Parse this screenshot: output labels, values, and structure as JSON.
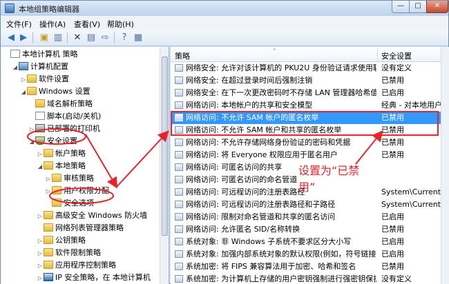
{
  "window": {
    "title": "本地组策略编辑器"
  },
  "caption_buttons": {
    "minimize": "—",
    "maximize": "□",
    "close": "✕"
  },
  "menu": [
    {
      "label": "文件(F)"
    },
    {
      "label": "操作(A)"
    },
    {
      "label": "查看(V)"
    },
    {
      "label": "帮助(H)"
    }
  ],
  "toolbar": {
    "icons": [
      "back-arrow-icon",
      "forward-arrow-icon",
      "up-folder-icon",
      "show-hide-tree-icon",
      "delete-icon",
      "properties-icon",
      "export-list-icon",
      "help-icon",
      "filter-icon"
    ]
  },
  "tree": [
    {
      "label": "本地计算机 策略",
      "indent": 0,
      "icon": "doc",
      "toggle": ""
    },
    {
      "label": "计算机配置",
      "indent": 1,
      "icon": "computer",
      "toggle": "◢"
    },
    {
      "label": "软件设置",
      "indent": 2,
      "icon": "folder",
      "toggle": "▷"
    },
    {
      "label": "Windows 设置",
      "indent": 2,
      "icon": "folder",
      "toggle": "◢"
    },
    {
      "label": "域名解析策略",
      "indent": 3,
      "icon": "folder",
      "toggle": ""
    },
    {
      "label": "脚本(启动/关机)",
      "indent": 3,
      "icon": "doc",
      "toggle": ""
    },
    {
      "label": "已部署的打印机",
      "indent": 3,
      "icon": "printer",
      "toggle": "▷"
    },
    {
      "label": "安全设置",
      "indent": 3,
      "icon": "shield",
      "toggle": "◢"
    },
    {
      "label": "帐户策略",
      "indent": 4,
      "icon": "folder",
      "toggle": "▷"
    },
    {
      "label": "本地策略",
      "indent": 4,
      "icon": "folder",
      "toggle": "◢"
    },
    {
      "label": "审核策略",
      "indent": 5,
      "icon": "folder",
      "toggle": "▷"
    },
    {
      "label": "用户权限分配",
      "indent": 5,
      "icon": "folder",
      "toggle": "▷"
    },
    {
      "label": "安全选项",
      "indent": 5,
      "icon": "folder",
      "toggle": ""
    },
    {
      "label": "高级安全 Windows 防火墙",
      "indent": 4,
      "icon": "folder",
      "toggle": "▷"
    },
    {
      "label": "网络列表管理器策略",
      "indent": 4,
      "icon": "folder",
      "toggle": ""
    },
    {
      "label": "公钥策略",
      "indent": 4,
      "icon": "folder",
      "toggle": "▷"
    },
    {
      "label": "软件限制策略",
      "indent": 4,
      "icon": "folder",
      "toggle": "▷"
    },
    {
      "label": "应用程序控制策略",
      "indent": 4,
      "icon": "folder",
      "toggle": "▷"
    },
    {
      "label": "IP 安全策略，在 本地计算机",
      "indent": 4,
      "icon": "ipsec",
      "toggle": "▷"
    },
    {
      "label": "高级审核策略配置",
      "indent": 4,
      "icon": "folder",
      "toggle": "▷"
    }
  ],
  "list": {
    "columns": {
      "policy": "策略",
      "setting": "安全设置"
    },
    "rows": [
      {
        "policy": "网络安全: 允许对该计算机的 PKU2U 身份验证请求使用联...",
        "setting": "没有定义",
        "selected": false
      },
      {
        "policy": "网络安全: 在超过登录时间后强制注销",
        "setting": "已禁用",
        "selected": false
      },
      {
        "policy": "网络安全: 在下一次更改密码时不存储 LAN 管理器哈希值",
        "setting": "已启用",
        "selected": false
      },
      {
        "policy": "网络访问: 本地帐户的共享和安全模型",
        "setting": "经典 - 对本地用户",
        "selected": false
      },
      {
        "policy": "网络访问: 不允许 SAM 帐户的匿名枚举",
        "setting": "已禁用",
        "selected": true
      },
      {
        "policy": "网络访问: 不允许 SAM 帐户和共享的匿名枚举",
        "setting": "已禁用",
        "selected": false
      },
      {
        "policy": "网络访问: 不允许存储网络身份验证的密码和凭据",
        "setting": "已禁用",
        "selected": false
      },
      {
        "policy": "网络访问: 将 Everyone 权限应用于匿名用户",
        "setting": "已禁用",
        "selected": false
      },
      {
        "policy": "网络访问: 可匿名访问的共享",
        "setting": "",
        "selected": false
      },
      {
        "policy": "网络访问: 可匿名访问的命名管道",
        "setting": "",
        "selected": false
      },
      {
        "policy": "网络访问: 可远程访问的注册表路径",
        "setting": "System\\CurrentC",
        "selected": false
      },
      {
        "policy": "网络访问: 可远程访问的注册表路径和子路径",
        "setting": "System\\CurrentC",
        "selected": false
      },
      {
        "policy": "网络访问: 限制对命名管道和共享的匿名访问",
        "setting": "已启用",
        "selected": false
      },
      {
        "policy": "网络访问: 允许匿名 SID/名称转换",
        "setting": "已禁用",
        "selected": false
      },
      {
        "policy": "系统对象: 非 Windows 子系统不要求区分大小写",
        "setting": "已启用",
        "selected": false
      },
      {
        "policy": "系统对象: 加强内部系统对象的默认权限(例如，符号链接)",
        "setting": "已启用",
        "selected": false
      },
      {
        "policy": "系统加密: 将 FIPS 兼容算法用于加密、哈希和签名",
        "setting": "已禁用",
        "selected": false
      },
      {
        "policy": "系统加密: 为计算机上存储的用户密钥强制进行强密钥保护",
        "setting": "没有定义",
        "selected": false
      }
    ]
  },
  "annotation": {
    "text": "设置为“已禁用”",
    "color": "#e8232a"
  }
}
